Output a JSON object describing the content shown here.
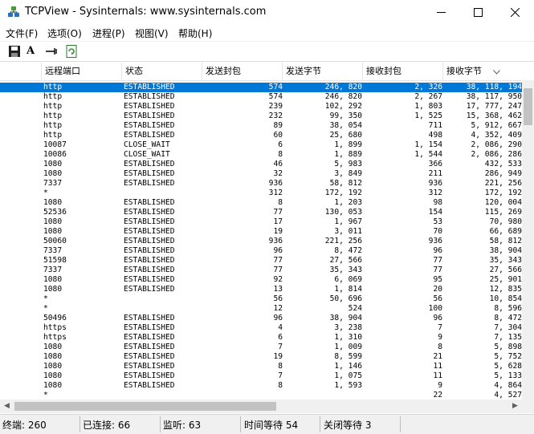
{
  "window": {
    "title": "TCPView - Sysinternals: www.sysinternals.com"
  },
  "menu": [
    "文件(F)",
    "选项(O)",
    "进程(P)",
    "视图(V)",
    "帮助(H)"
  ],
  "toolbar": {
    "font_label": "A"
  },
  "columns": [
    "远程端口",
    "状态",
    "发送封包",
    "发送字节",
    "接收封包",
    "接收字节"
  ],
  "rows": [
    [
      "http",
      "ESTABLISHED",
      "574",
      "246, 820",
      "2, 326",
      "38, 118, 194"
    ],
    [
      "http",
      "ESTABLISHED",
      "574",
      "246, 820",
      "2, 267",
      "38, 117, 950"
    ],
    [
      "http",
      "ESTABLISHED",
      "239",
      "102, 292",
      "1, 803",
      "17, 777, 247"
    ],
    [
      "http",
      "ESTABLISHED",
      "232",
      "99, 350",
      "1, 525",
      "15, 368, 462"
    ],
    [
      "http",
      "ESTABLISHED",
      "89",
      "38, 054",
      "711",
      "5, 912, 667"
    ],
    [
      "http",
      "ESTABLISHED",
      "60",
      "25, 680",
      "498",
      "4, 352, 409"
    ],
    [
      "10087",
      "CLOSE_WAIT",
      "6",
      "1, 899",
      "1, 154",
      "2, 086, 290"
    ],
    [
      "10086",
      "CLOSE_WAIT",
      "8",
      "1, 889",
      "1, 544",
      "2, 086, 286"
    ],
    [
      "1080",
      "ESTABLISHED",
      "46",
      "5, 983",
      "366",
      "432, 533"
    ],
    [
      "1080",
      "ESTABLISHED",
      "32",
      "3, 849",
      "211",
      "286, 949"
    ],
    [
      "7337",
      "ESTABLISHED",
      "936",
      "58, 812",
      "936",
      "221, 256"
    ],
    [
      "*",
      "",
      "312",
      "172, 192",
      "312",
      "172, 192"
    ],
    [
      "1080",
      "ESTABLISHED",
      "8",
      "1, 203",
      "98",
      "120, 004"
    ],
    [
      "52536",
      "ESTABLISHED",
      "77",
      "130, 053",
      "154",
      "115, 269"
    ],
    [
      "1080",
      "ESTABLISHED",
      "17",
      "1, 967",
      "53",
      "70, 980"
    ],
    [
      "1080",
      "ESTABLISHED",
      "19",
      "3, 011",
      "70",
      "66, 689"
    ],
    [
      "50060",
      "ESTABLISHED",
      "936",
      "221, 256",
      "936",
      "58, 812"
    ],
    [
      "7337",
      "ESTABLISHED",
      "96",
      "8, 472",
      "96",
      "38, 904"
    ],
    [
      "51598",
      "ESTABLISHED",
      "77",
      "27, 566",
      "77",
      "35, 343"
    ],
    [
      "7337",
      "ESTABLISHED",
      "77",
      "35, 343",
      "77",
      "27, 566"
    ],
    [
      "1080",
      "ESTABLISHED",
      "92",
      "6, 069",
      "95",
      "25, 901"
    ],
    [
      "1080",
      "ESTABLISHED",
      "13",
      "1, 814",
      "20",
      "12, 835"
    ],
    [
      "*",
      "",
      "56",
      "50, 696",
      "56",
      "10, 854"
    ],
    [
      "*",
      "",
      "12",
      "524",
      "100",
      "8, 596"
    ],
    [
      "50496",
      "ESTABLISHED",
      "96",
      "38, 904",
      "96",
      "8, 472"
    ],
    [
      "https",
      "ESTABLISHED",
      "4",
      "3, 238",
      "7",
      "7, 304"
    ],
    [
      "https",
      "ESTABLISHED",
      "6",
      "1, 310",
      "9",
      "7, 135"
    ],
    [
      "1080",
      "ESTABLISHED",
      "7",
      "1, 009",
      "8",
      "5, 898"
    ],
    [
      "1080",
      "ESTABLISHED",
      "19",
      "8, 599",
      "21",
      "5, 752"
    ],
    [
      "1080",
      "ESTABLISHED",
      "8",
      "1, 146",
      "11",
      "5, 628"
    ],
    [
      "1080",
      "ESTABLISHED",
      "7",
      "1, 075",
      "11",
      "5, 133"
    ],
    [
      "1080",
      "ESTABLISHED",
      "8",
      "1, 593",
      "9",
      "4, 864"
    ],
    [
      "*",
      "",
      "",
      "",
      "22",
      "4, 527"
    ]
  ],
  "status": {
    "endpoints": "终端: 260",
    "established": "已连接: 66",
    "listening": "监听: 63",
    "time_wait": "时间等待 54",
    "close_wait": "关闭等待 3"
  }
}
